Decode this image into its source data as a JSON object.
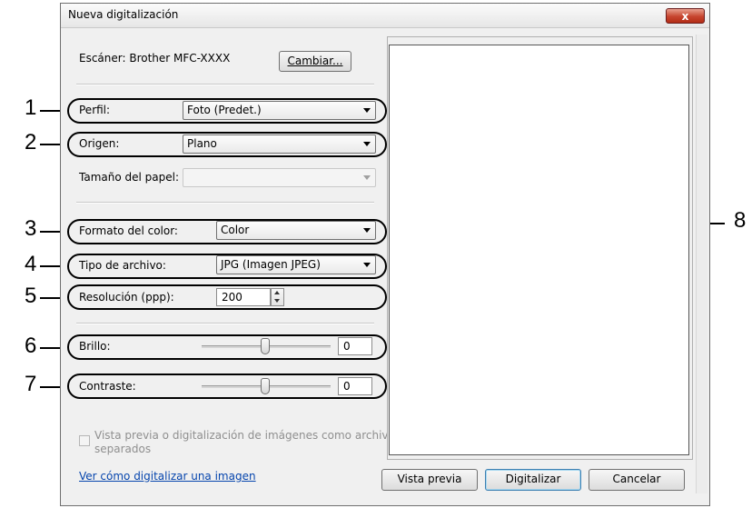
{
  "window": {
    "title": "Nueva digitalización",
    "close_glyph": "x"
  },
  "scanner": {
    "label": "Escáner: Brother MFC-XXXX",
    "change_button": "Cambiar..."
  },
  "fields": {
    "profile": {
      "label": "Perfil:",
      "value": "Foto (Predet.)"
    },
    "source": {
      "label": "Origen:",
      "value": "Plano"
    },
    "paper_size": {
      "label": "Tamaño del papel:",
      "value": ""
    },
    "color_format": {
      "label": "Formato del color:",
      "value": "Color"
    },
    "file_type": {
      "label": "Tipo de archivo:",
      "value": "JPG (Imagen JPEG)"
    },
    "resolution": {
      "label": "Resolución (ppp):",
      "value": "200"
    },
    "brightness": {
      "label": "Brillo:",
      "value": "0",
      "level": 0
    },
    "contrast": {
      "label": "Contraste:",
      "value": "0",
      "level": 0
    }
  },
  "options": {
    "separate_files": {
      "label_line1": "Vista previa o digitalización de imágenes como archivos",
      "label_line2": "separados",
      "checked": false
    }
  },
  "help_link": "Ver cómo digitalizar una imagen",
  "buttons": {
    "preview": "Vista previa",
    "scan": "Digitalizar",
    "cancel": "Cancelar"
  },
  "callouts": [
    "1",
    "2",
    "3",
    "4",
    "5",
    "6",
    "7",
    "8"
  ],
  "colors": {
    "accent": "#3c7fb1",
    "close": "#c7442e",
    "link": "#0645ad"
  }
}
